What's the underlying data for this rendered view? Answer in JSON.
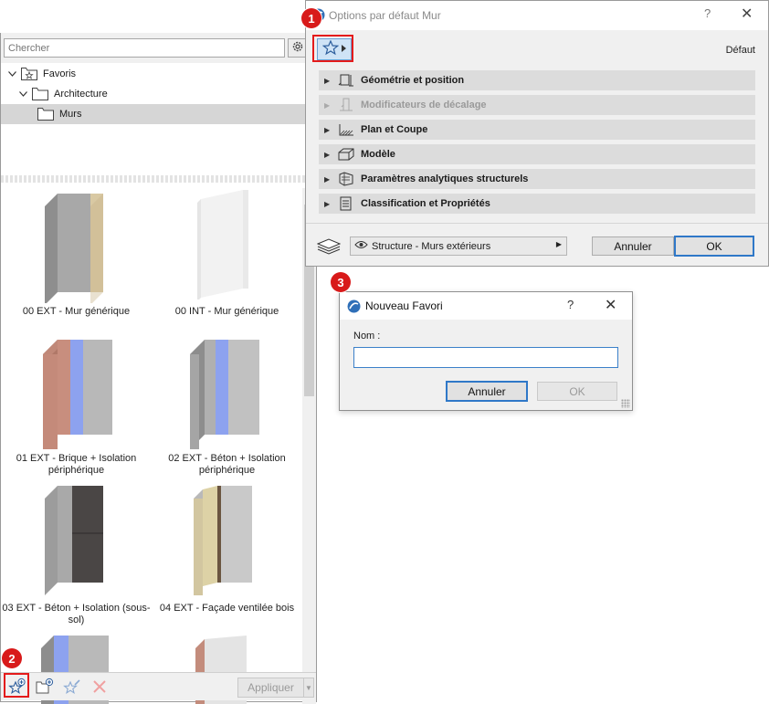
{
  "favorites_panel": {
    "search": {
      "placeholder": "Chercher",
      "value": ""
    },
    "tree": [
      {
        "label": "Favoris",
        "icon": "star-folder-icon",
        "expanded": true
      },
      {
        "label": "Architecture",
        "icon": "folder-icon",
        "expanded": true
      },
      {
        "label": "Murs",
        "icon": "folder-icon",
        "selected": true
      }
    ],
    "items": [
      {
        "label": "00 EXT - Mur générique"
      },
      {
        "label": "00 INT - Mur générique"
      },
      {
        "label": "01 EXT - Brique + Isolation périphérique"
      },
      {
        "label": "02 EXT - Béton + Isolation périphérique"
      },
      {
        "label": "03 EXT - Béton + Isolation (sous-sol)"
      },
      {
        "label": "04 EXT - Façade ventilée bois"
      }
    ],
    "bottom_bar": {
      "apply_label": "Appliquer"
    }
  },
  "wall_dialog": {
    "title": "Options par défaut Mur",
    "help": "?",
    "close": "✕",
    "default_label": "Défaut",
    "panels": [
      {
        "label": "Géométrie et position",
        "icon": "geometry-icon",
        "enabled": true
      },
      {
        "label": "Modificateurs de décalage",
        "icon": "offset-icon",
        "enabled": false
      },
      {
        "label": "Plan et Coupe",
        "icon": "plan-section-icon",
        "enabled": true
      },
      {
        "label": "Modèle",
        "icon": "model-icon",
        "enabled": true
      },
      {
        "label": "Paramètres analytiques structurels",
        "icon": "structural-icon",
        "enabled": true
      },
      {
        "label": "Classification et Propriétés",
        "icon": "classification-icon",
        "enabled": true
      }
    ],
    "layer": "Structure - Murs extérieurs",
    "cancel_label": "Annuler",
    "ok_label": "OK"
  },
  "new_favorite_dialog": {
    "title": "Nouveau Favori",
    "help": "?",
    "close": "✕",
    "name_label": "Nom :",
    "name_value": "",
    "cancel_label": "Annuler",
    "ok_label": "OK"
  },
  "callouts": [
    "1",
    "2",
    "3"
  ],
  "colors": {
    "highlight": "#e41b1b",
    "accent_blue": "#2f78c8",
    "badge": "#d81a1a"
  }
}
